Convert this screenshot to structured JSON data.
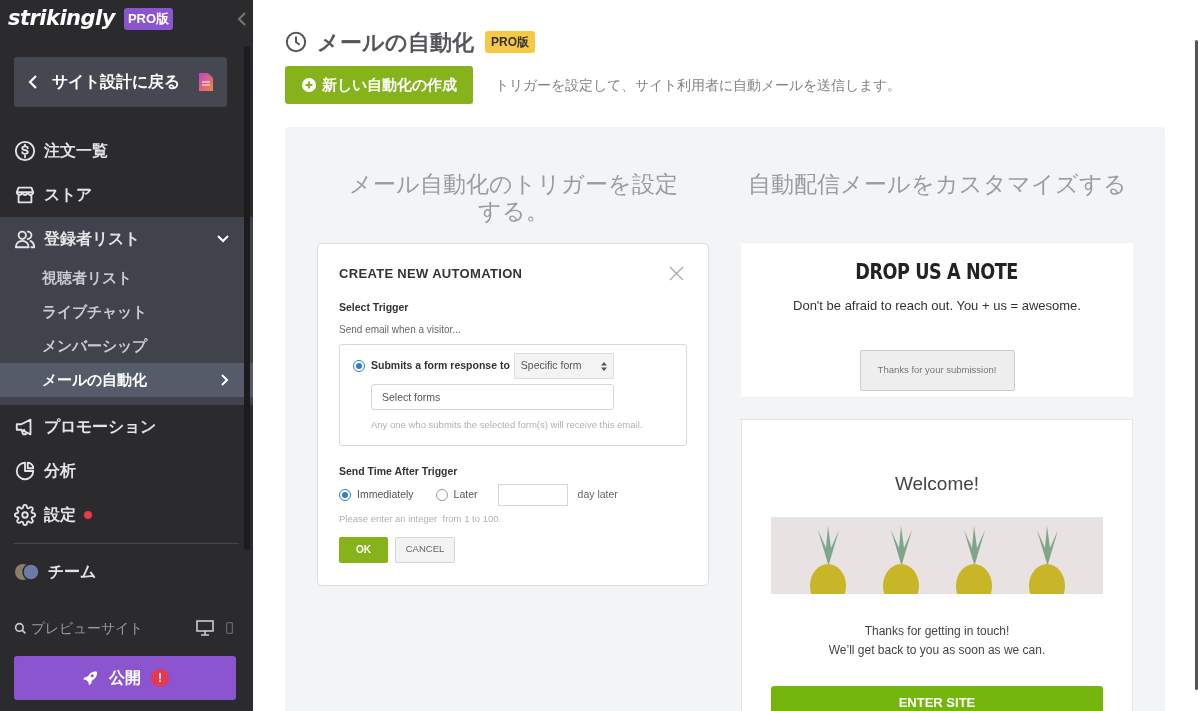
{
  "brand": {
    "logo": "strikingly",
    "badge": "PRO版"
  },
  "back_button": {
    "label": "サイト設計に戻る"
  },
  "nav": [
    {
      "label": "注文一覧",
      "selected": false
    },
    {
      "label": "ストア",
      "selected": false
    },
    {
      "label": "登録者リスト",
      "selected": false,
      "expanded": true,
      "children": [
        {
          "label": "視聴者リスト",
          "selected": false
        },
        {
          "label": "ライブチャット",
          "selected": false
        },
        {
          "label": "メンバーシップ",
          "selected": false
        },
        {
          "label": "メールの自動化",
          "selected": true
        }
      ]
    },
    {
      "label": "プロモーション",
      "selected": false
    },
    {
      "label": "分析",
      "selected": false
    },
    {
      "label": "設定",
      "selected": false,
      "notification": true
    },
    {
      "label": "チーム",
      "selected": false
    }
  ],
  "preview": {
    "label": "プレビューサイト"
  },
  "publish": {
    "label": "公開",
    "alert": "!"
  },
  "page": {
    "title": "メールの自動化",
    "badge": "PRO版",
    "create_button": "新しい自動化の作成",
    "description": "トリガーを設定して、サイト利用者に自動メールを送信します。"
  },
  "panel": {
    "left_heading": "メール自動化のトリガーを設定する。",
    "right_heading": "自動配信メールをカスタマイズする",
    "dialog": {
      "title": "CREATE NEW AUTOMATION",
      "trigger_label": "Select Trigger",
      "trigger_hint": "Send email when a visitor...",
      "trigger_option": {
        "label": "Submits a form response to",
        "selected": true
      },
      "form_select": {
        "value": "Specific form"
      },
      "forms_field": {
        "placeholder": "Select forms"
      },
      "forms_note": "Any one who submits the selected form(s) will receive this email.",
      "send_time_label": "Send Time After Trigger",
      "send_time_options": [
        {
          "label": "Immediately",
          "selected": true
        },
        {
          "label": "Later",
          "selected": false
        }
      ],
      "days_suffix": "day later",
      "days_hint": "Please enter an integer  from 1 to 100.",
      "ok": "OK",
      "cancel": "CANCEL"
    },
    "form_preview": {
      "title": "DROP US A NOTE",
      "subtitle": "Don't be afraid to reach out. You + us = awesome.",
      "button": "Thanks for your submission!"
    },
    "email_preview": {
      "title": "Welcome!",
      "lines": [
        "Thanks for getting in touch!",
        "We’ll get back to you as soon as we can."
      ],
      "button": "ENTER SITE"
    }
  }
}
